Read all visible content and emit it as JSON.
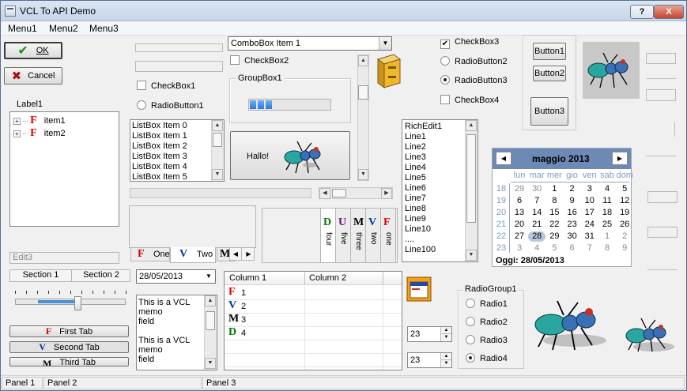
{
  "window": {
    "title": "VCL To API Demo",
    "help_label": "?",
    "close_label": "X"
  },
  "menu": [
    "Menu1",
    "Menu2",
    "Menu3"
  ],
  "buttons": {
    "ok": "OK",
    "cancel": "Cancel",
    "hallo": "Hallo!",
    "button1": "Button1",
    "button2": "Button2",
    "button3": "Button3"
  },
  "label1": "Label1",
  "tree": [
    "item1",
    "item2"
  ],
  "edit3": {
    "placeholder": "Edit3"
  },
  "header_sections": [
    "Section 1",
    "Section 2"
  ],
  "trackbar": {
    "position": 0.58
  },
  "tab_buttons": [
    {
      "glyph": "F",
      "label": "First Tab"
    },
    {
      "glyph": "V",
      "label": "Second Tab"
    },
    {
      "glyph": "M",
      "label": "Third Tab"
    }
  ],
  "checkbox1": "CheckBox1",
  "radiobutton1": "RadioButton1",
  "listbox": [
    "ListBox Item 0",
    "ListBox Item 1",
    "ListBox Item 2",
    "ListBox Item 3",
    "ListBox Item 4",
    "ListBox Item 5"
  ],
  "combobox": {
    "value": "ComboBox Item 1"
  },
  "checkbox2": "CheckBox2",
  "groupbox1": {
    "title": "GroupBox1",
    "progress": 0.3
  },
  "tabs_bottom": [
    {
      "glyph": "F",
      "label": "One"
    },
    {
      "glyph": "V",
      "label": "Two"
    },
    {
      "glyph": "M",
      "label": ""
    }
  ],
  "vertical_tabs": [
    {
      "glyph": "D",
      "label": "four"
    },
    {
      "glyph": "U",
      "label": "five"
    },
    {
      "glyph": "M",
      "label": "three"
    },
    {
      "glyph": "V",
      "label": "two"
    },
    {
      "glyph": "F",
      "label": "one"
    }
  ],
  "date_picker": {
    "value": "28/05/2013"
  },
  "memo": [
    "This is a VCL",
    "memo",
    "field",
    "",
    "This is a VCL",
    "memo",
    "field"
  ],
  "listview": {
    "columns": [
      "Column 1",
      "Column 2"
    ],
    "rows": [
      {
        "glyph": "F",
        "value": "1"
      },
      {
        "glyph": "V",
        "value": "2"
      },
      {
        "glyph": "M",
        "value": "3"
      },
      {
        "glyph": "D",
        "value": "4"
      }
    ]
  },
  "checkboxes_right": [
    {
      "label": "CheckBox3",
      "checked": true
    },
    {
      "label": "CheckBox4",
      "checked": false
    }
  ],
  "radios_right": [
    {
      "label": "RadioButton2",
      "checked": false
    },
    {
      "label": "RadioButton3",
      "checked": true
    }
  ],
  "richedit": [
    "RichEdit1",
    "Line1",
    "Line2",
    "Line3",
    "Line4",
    "Line5",
    "Line6",
    "Line7",
    "Line8",
    "Line9",
    "Line10",
    "....",
    "Line100"
  ],
  "calendar": {
    "month_title": "maggio 2013",
    "day_names": [
      "lun",
      "mar",
      "mer",
      "gio",
      "ven",
      "sab",
      "dom"
    ],
    "weeks": [
      {
        "num": "18",
        "days": [
          "29",
          "30",
          "1",
          "2",
          "3",
          "4",
          "5"
        ],
        "gray": [
          0,
          1
        ]
      },
      {
        "num": "19",
        "days": [
          "6",
          "7",
          "8",
          "9",
          "10",
          "11",
          "12"
        ],
        "gray": []
      },
      {
        "num": "20",
        "days": [
          "13",
          "14",
          "15",
          "16",
          "17",
          "18",
          "19"
        ],
        "gray": []
      },
      {
        "num": "21",
        "days": [
          "20",
          "21",
          "22",
          "23",
          "24",
          "25",
          "26"
        ],
        "gray": []
      },
      {
        "num": "22",
        "days": [
          "27",
          "28",
          "29",
          "30",
          "31",
          "1",
          "2"
        ],
        "gray": [
          5,
          6
        ]
      },
      {
        "num": "23",
        "days": [
          "3",
          "4",
          "5",
          "6",
          "7",
          "8",
          "9"
        ],
        "gray": [
          0,
          1,
          2,
          3,
          4,
          5,
          6
        ]
      }
    ],
    "selected": "28",
    "today_label": "Oggi: 28/05/2013"
  },
  "radiogroup1": {
    "title": "RadioGroup1",
    "items": [
      {
        "label": "Radio1",
        "checked": false
      },
      {
        "label": "Radio2",
        "checked": false
      },
      {
        "label": "Radio3",
        "checked": false
      },
      {
        "label": "Radio4",
        "checked": true
      }
    ]
  },
  "spin_edits": [
    "23",
    "23"
  ],
  "status_panels": [
    "Panel 1",
    "Panel 2",
    "Panel 3"
  ]
}
